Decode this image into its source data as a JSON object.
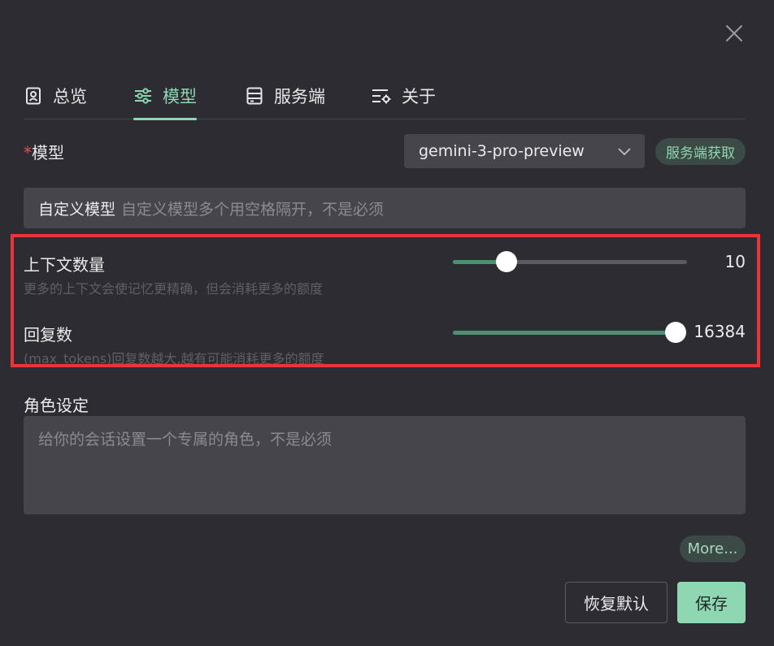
{
  "tabs": [
    {
      "label": "总览",
      "icon": "document-person-icon",
      "active": false
    },
    {
      "label": "模型",
      "icon": "sliders-icon",
      "active": true
    },
    {
      "label": "服务端",
      "icon": "server-icon",
      "active": false
    },
    {
      "label": "关于",
      "icon": "list-settings-icon",
      "active": false
    }
  ],
  "model": {
    "required_mark": "*",
    "label": "模型",
    "selected": "gemini-3-pro-preview",
    "fetch_label": "服务端获取"
  },
  "custom_model": {
    "prefix": "自定义模型",
    "placeholder": "自定义模型多个用空格隔开，不是必须"
  },
  "context_count": {
    "title": "上下文数量",
    "desc": "更多的上下文会使记忆更精确，但会消耗更多的额度",
    "value": "10",
    "fill_fraction": 0.23
  },
  "max_tokens": {
    "title": "回复数",
    "desc": "(max_tokens)回复数越大,越有可能消耗更多的额度",
    "value": "16384",
    "fill_fraction": 1.0
  },
  "role": {
    "label": "角色设定",
    "placeholder": "给你的会话设置一个专属的角色，不是必须"
  },
  "buttons": {
    "more": "More...",
    "reset": "恢复默认",
    "save": "保存"
  },
  "colors": {
    "accent": "#8fd6b3",
    "highlight": "#e8343a",
    "background": "#2c2c32"
  }
}
